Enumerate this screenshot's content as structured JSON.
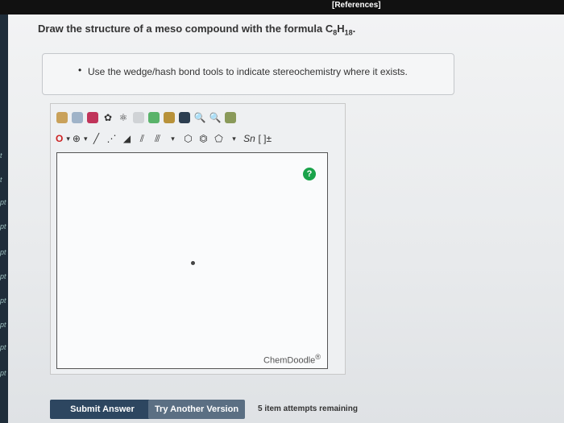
{
  "header": {
    "references": "[References]"
  },
  "question": {
    "prefix": "Draw the structure of a meso compound with the formula C",
    "c_sub": "8",
    "h": "H",
    "h_sub": "18",
    "suffix": "."
  },
  "hint": {
    "bullet": "•",
    "text": "Use the wedge/hash bond tools to indicate stereochemistry where it exists."
  },
  "left_points": [
    "t",
    "t",
    "pt",
    "pt",
    "pt",
    "pt",
    "pt",
    "pt",
    "pt",
    "pt"
  ],
  "toolbar": {
    "row1_icons": [
      "hand-icon",
      "eraser-icon",
      "pen-icon",
      "ring-template-icon",
      "templates-icon",
      "undo-icon",
      "redo-icon",
      "copy-icon",
      "paste-icon",
      "zoom-in-icon",
      "zoom-out-icon",
      "clean-icon"
    ],
    "row2": {
      "atom_label": "O",
      "charge": "⊕",
      "bracket": "[ ]±",
      "sn": "Sn"
    }
  },
  "canvas": {
    "help": "?",
    "brand": "ChemDoodle",
    "brand_mark": "®"
  },
  "buttons": {
    "submit": "Submit Answer",
    "try": "Try Another Version"
  },
  "attempts": "5 item attempts remaining"
}
